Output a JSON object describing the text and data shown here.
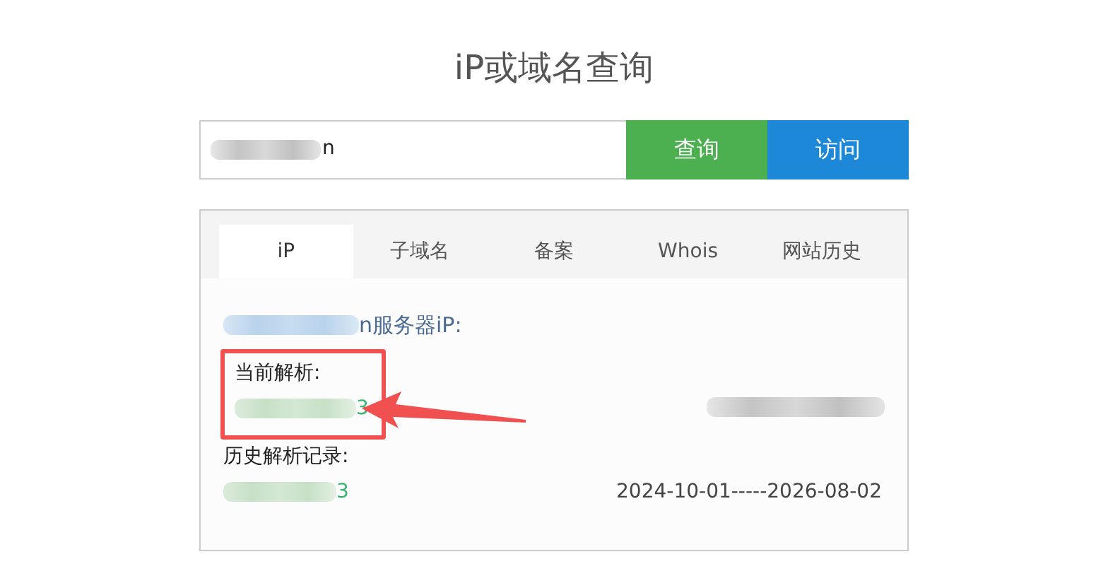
{
  "title": "iP或域名查询",
  "search": {
    "value": "n",
    "redacted": true
  },
  "buttons": [
    {
      "label": "查询",
      "kind": "query"
    },
    {
      "label": "访问",
      "kind": "visit"
    }
  ],
  "tabs": [
    {
      "label": "iP",
      "selected": true
    },
    {
      "label": "子域名",
      "selected": false
    },
    {
      "label": "备案",
      "selected": false
    },
    {
      "label": "Whois",
      "selected": false
    },
    {
      "label": "网站历史",
      "selected": false
    }
  ],
  "server_heading": {
    "text": "n服务器iP:",
    "redacted": true
  },
  "current": {
    "label": "当前解析:",
    "highlighted": true,
    "ip": "3",
    "ip_redacted": true,
    "location_redacted": true
  },
  "history": {
    "label": "历史解析记录:",
    "records": [
      {
        "ip": "3",
        "ip_redacted": true,
        "period": "2024-10-01-----2026-08-02"
      }
    ]
  }
}
